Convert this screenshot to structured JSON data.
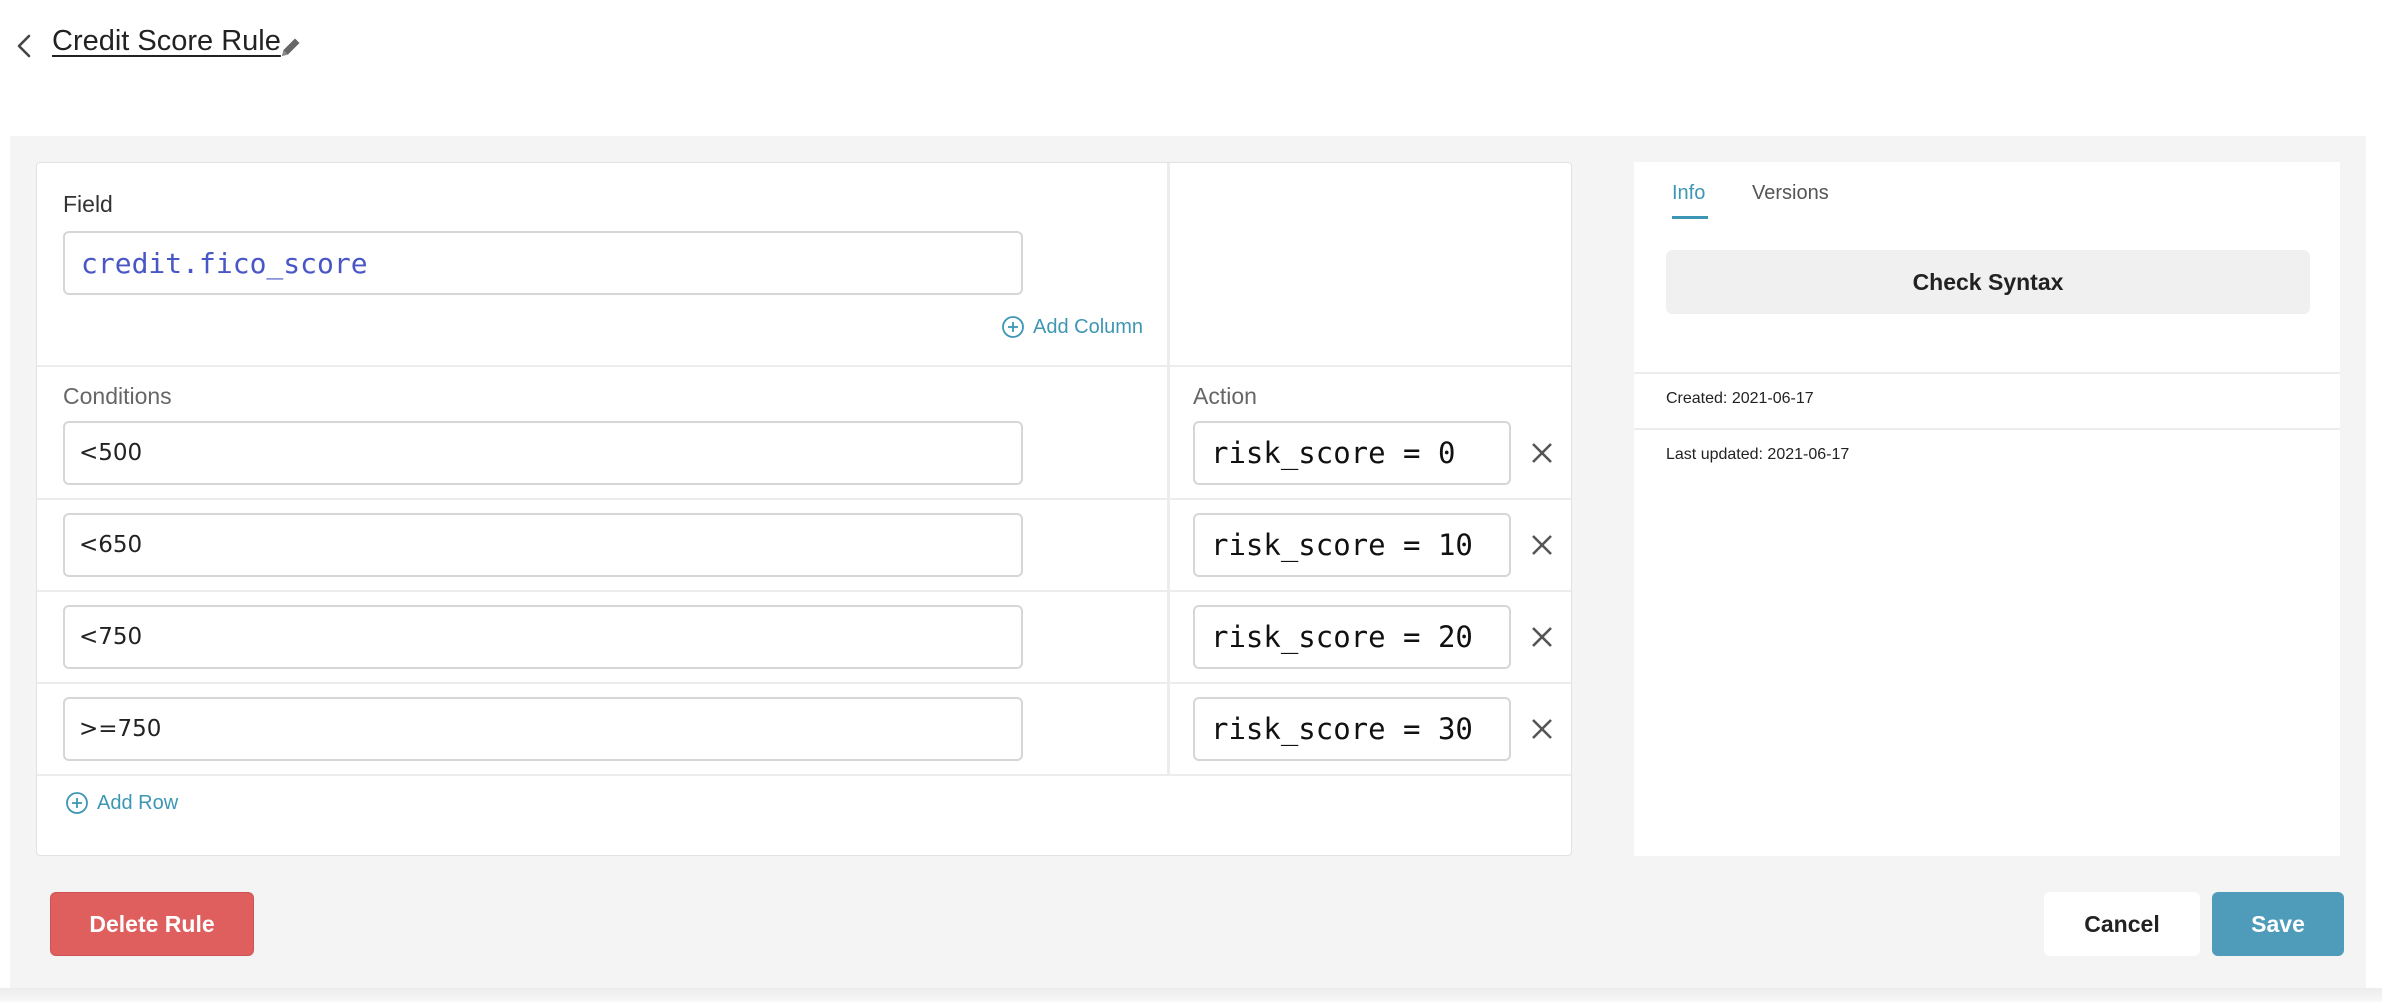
{
  "header": {
    "title": "Credit Score Rule"
  },
  "table": {
    "field_label": "Field",
    "field_value": "credit.fico_score",
    "add_column_label": "Add Column",
    "conditions_label": "Conditions",
    "action_label": "Action",
    "rows": [
      {
        "condition": "<500",
        "action": "risk_score = 0"
      },
      {
        "condition": "<650",
        "action": "risk_score = 10"
      },
      {
        "condition": "<750",
        "action": "risk_score = 20"
      },
      {
        "condition": ">=750",
        "action": "risk_score = 30"
      }
    ],
    "add_row_label": "Add Row"
  },
  "panel": {
    "tabs": [
      {
        "label": "Info",
        "active": true
      },
      {
        "label": "Versions",
        "active": false
      }
    ],
    "check_syntax_label": "Check Syntax",
    "created_label": "Created:",
    "created_value": "2021-06-17",
    "updated_label": "Last updated:",
    "updated_value": "2021-06-17"
  },
  "footer": {
    "delete_label": "Delete Rule",
    "cancel_label": "Cancel",
    "save_label": "Save"
  },
  "colors": {
    "accent": "#3d97b4",
    "delete": "#df5f5f",
    "save": "#4f9bba",
    "field_text": "#4856c6"
  }
}
